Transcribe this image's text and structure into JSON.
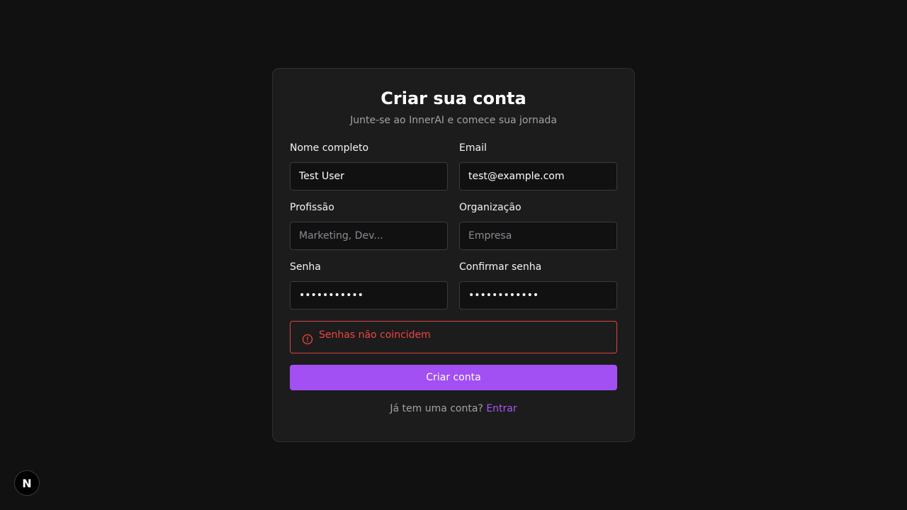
{
  "header": {
    "title": "Criar sua conta",
    "subtitle": "Junte-se ao InnerAI e comece sua jornada"
  },
  "form": {
    "name": {
      "label": "Nome completo",
      "value": "Test User",
      "placeholder": ""
    },
    "email": {
      "label": "Email",
      "value": "test@example.com",
      "placeholder": ""
    },
    "profession": {
      "label": "Profissão",
      "value": "",
      "placeholder": "Marketing, Dev..."
    },
    "organization": {
      "label": "Organização",
      "value": "",
      "placeholder": "Empresa"
    },
    "password": {
      "label": "Senha",
      "value": "•••••••••••",
      "placeholder": ""
    },
    "confirm_password": {
      "label": "Confirmar senha",
      "value": "••••••••••••",
      "placeholder": ""
    },
    "error": {
      "icon": "alert-circle-icon",
      "text": "Senhas não coincidem",
      "color": "#ef4444"
    },
    "submit_label": "Criar conta"
  },
  "footer": {
    "prompt": "Já tem uma conta?",
    "link_label": "Entrar"
  },
  "badge": {
    "icon": "nextjs-logo-icon",
    "text": "N"
  },
  "colors": {
    "background": "#111111",
    "card": "#1c1c1c",
    "accent": "#a24ff3",
    "link": "#a855f7",
    "error": "#ef4444"
  }
}
